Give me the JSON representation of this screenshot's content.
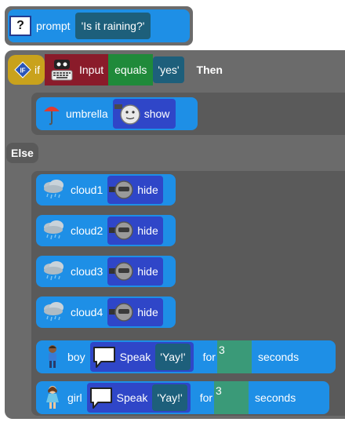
{
  "prompt_block": {
    "keyword": "prompt",
    "question": "'Is it raining?'"
  },
  "if_block": {
    "if_label": "if",
    "input_label": "Input",
    "operator": "equals",
    "value": "'yes'",
    "then_label": "Then"
  },
  "then_branch": {
    "sprite": "umbrella",
    "action": "show"
  },
  "else_label": "Else",
  "else_branch": [
    {
      "sprite": "cloud1",
      "action": "hide"
    },
    {
      "sprite": "cloud2",
      "action": "hide"
    },
    {
      "sprite": "cloud3",
      "action": "hide"
    },
    {
      "sprite": "cloud4",
      "action": "hide"
    }
  ],
  "speak_rows": [
    {
      "sprite": "boy",
      "action": "Speak",
      "text": "'Yay!'",
      "for_label": "for",
      "duration": "3",
      "unit": "seconds"
    },
    {
      "sprite": "girl",
      "action": "Speak",
      "text": "'Yay!'",
      "for_label": "for",
      "duration": "3",
      "unit": "seconds"
    }
  ],
  "colors": {
    "workspace_gray": "#6b6b6b",
    "block_blue": "#1e8fe6",
    "block_navy": "#2f46c8",
    "block_teal": "#1d5f7b",
    "if_gold": "#c9a21c",
    "input_maroon": "#8a1b2a",
    "equals_green": "#1f8a3a",
    "duration_green": "#3a9a78"
  }
}
